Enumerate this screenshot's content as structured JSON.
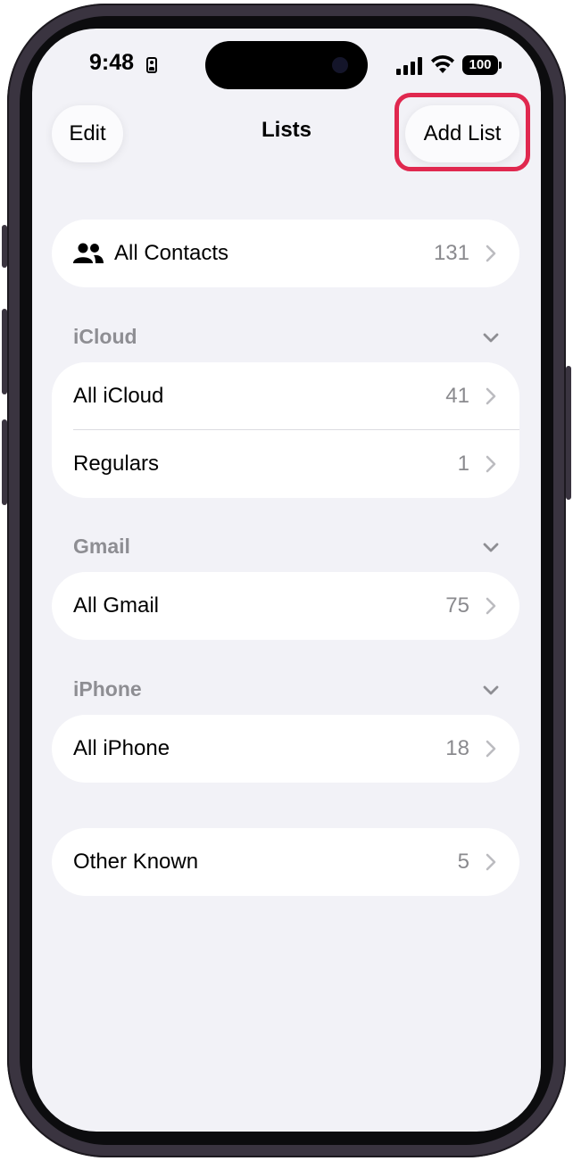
{
  "status_bar": {
    "time": "9:48",
    "battery": "100"
  },
  "nav": {
    "edit_label": "Edit",
    "title": "Lists",
    "add_label": "Add List"
  },
  "all_contacts": {
    "label": "All Contacts",
    "count": "131"
  },
  "sections": [
    {
      "title": "iCloud",
      "rows": [
        {
          "label": "All iCloud",
          "count": "41"
        },
        {
          "label": "Regulars",
          "count": "1"
        }
      ]
    },
    {
      "title": "Gmail",
      "rows": [
        {
          "label": "All Gmail",
          "count": "75"
        }
      ]
    },
    {
      "title": "iPhone",
      "rows": [
        {
          "label": "All iPhone",
          "count": "18"
        }
      ]
    }
  ],
  "other": {
    "label": "Other Known",
    "count": "5"
  },
  "colors": {
    "highlight": "#e0284f",
    "background": "#f2f2f7",
    "secondary_text": "#8a8a8e"
  },
  "icons": [
    "contacts-icon",
    "chevron-right-icon",
    "chevron-down-icon",
    "signal-icon",
    "wifi-icon",
    "battery-icon"
  ]
}
